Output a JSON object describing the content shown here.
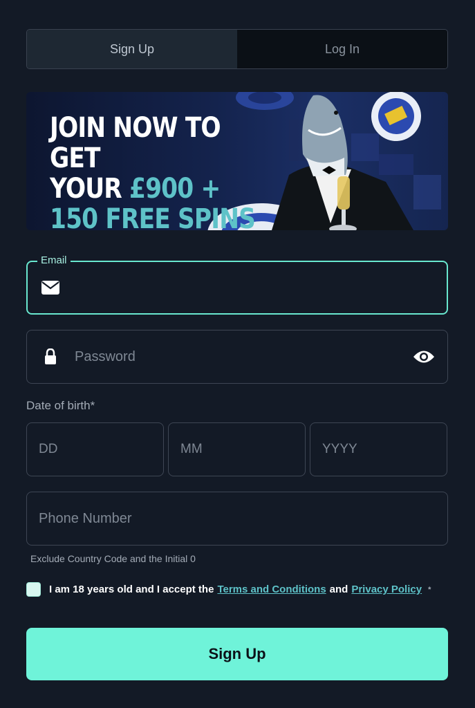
{
  "tabs": {
    "signup_label": "Sign Up",
    "login_label": "Log In"
  },
  "banner": {
    "line1": "JOIN NOW TO GET",
    "line2_prefix": "YOUR ",
    "line2_highlight": "£900 +",
    "line3": "150 FREE SPINS"
  },
  "form": {
    "email_label": "Email",
    "password_placeholder": "Password",
    "dob_label": "Date of birth*",
    "dob_day_placeholder": "DD",
    "dob_month_placeholder": "MM",
    "dob_year_placeholder": "YYYY",
    "phone_placeholder": "Phone Number",
    "phone_hint": "Exclude Country Code and the Initial 0"
  },
  "terms": {
    "prefix": "I am 18 years old and I accept the",
    "terms_link": "Terms and Conditions",
    "and": "and",
    "privacy_link": "Privacy Policy",
    "required_mark": "*"
  },
  "submit_label": "Sign Up",
  "colors": {
    "background": "#131a26",
    "accent": "#6ff3d9",
    "link": "#5ec2c8",
    "focus_border": "#69e8cf"
  },
  "icons": {
    "email": "envelope-icon",
    "password": "lock-icon",
    "toggle": "eye-icon"
  }
}
